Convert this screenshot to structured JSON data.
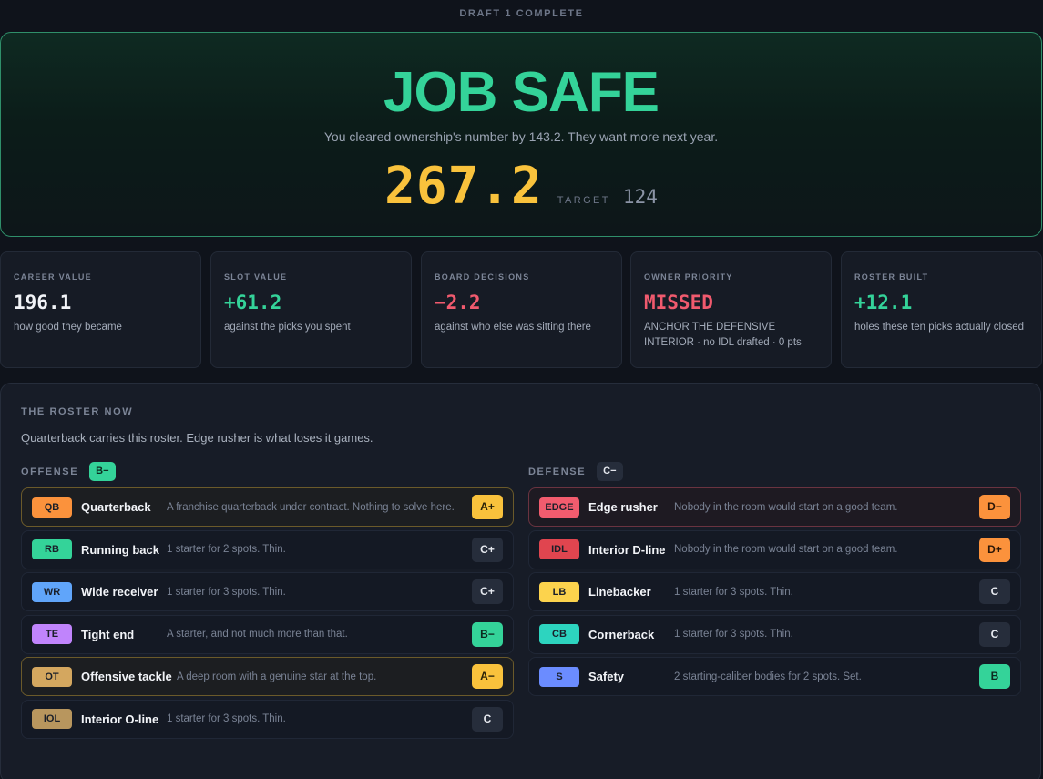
{
  "header": {
    "label": "DRAFT 1 COMPLETE"
  },
  "hero": {
    "verdict": "JOB SAFE",
    "subtitle": "You cleared ownership's number by 143.2. They want more next year.",
    "score": "267.2",
    "target_label": "TARGET",
    "target_value": "124"
  },
  "stats": [
    {
      "label": "CAREER VALUE",
      "value": "196.1",
      "desc": "how good they became",
      "color": "#f2f4f8"
    },
    {
      "label": "SLOT VALUE",
      "value": "+61.2",
      "desc": "against the picks you spent",
      "color": "#34d399"
    },
    {
      "label": "BOARD DECISIONS",
      "value": "−2.2",
      "desc": "against who else was sitting there",
      "color": "#f05a6e"
    },
    {
      "label": "OWNER PRIORITY",
      "value": "MISSED",
      "desc": "ANCHOR THE DEFENSIVE INTERIOR · no IDL drafted · 0 pts",
      "color": "#f05a6e"
    },
    {
      "label": "ROSTER BUILT",
      "value": "+12.1",
      "desc": "holes these ten picks actually closed",
      "color": "#34d399"
    }
  ],
  "roster": {
    "title": "THE ROSTER NOW",
    "summary": "Quarterback carries this roster. Edge rusher is what loses it games.",
    "offense": {
      "label": "OFFENSE",
      "grade": "B−",
      "rows": [
        {
          "code": "QB",
          "name": "Quarterback",
          "desc": "A franchise quarterback under contract. Nothing to solve here.",
          "grade": "A+"
        },
        {
          "code": "RB",
          "name": "Running back",
          "desc": "1 starter for 2 spots. Thin.",
          "grade": "C+"
        },
        {
          "code": "WR",
          "name": "Wide receiver",
          "desc": "1 starter for 3 spots. Thin.",
          "grade": "C+"
        },
        {
          "code": "TE",
          "name": "Tight end",
          "desc": "A starter, and not much more than that.",
          "grade": "B−"
        },
        {
          "code": "OT",
          "name": "Offensive tackle",
          "desc": "A deep room with a genuine star at the top.",
          "grade": "A−"
        },
        {
          "code": "IOL",
          "name": "Interior O-line",
          "desc": "1 starter for 3 spots. Thin.",
          "grade": "C"
        }
      ]
    },
    "defense": {
      "label": "DEFENSE",
      "grade": "C−",
      "rows": [
        {
          "code": "EDGE",
          "name": "Edge rusher",
          "desc": "Nobody in the room would start on a good team.",
          "grade": "D−"
        },
        {
          "code": "IDL",
          "name": "Interior D-line",
          "desc": "Nobody in the room would start on a good team.",
          "grade": "D+"
        },
        {
          "code": "LB",
          "name": "Linebacker",
          "desc": "1 starter for 3 spots. Thin.",
          "grade": "C"
        },
        {
          "code": "CB",
          "name": "Cornerback",
          "desc": "1 starter for 3 spots. Thin.",
          "grade": "C"
        },
        {
          "code": "S",
          "name": "Safety",
          "desc": "2 starting-caliber bodies for 2 spots. Set.",
          "grade": "B"
        }
      ]
    }
  },
  "colors": {
    "accent_green": "#34d399",
    "accent_gold": "#f9c23c",
    "accent_red": "#f05a6e"
  }
}
